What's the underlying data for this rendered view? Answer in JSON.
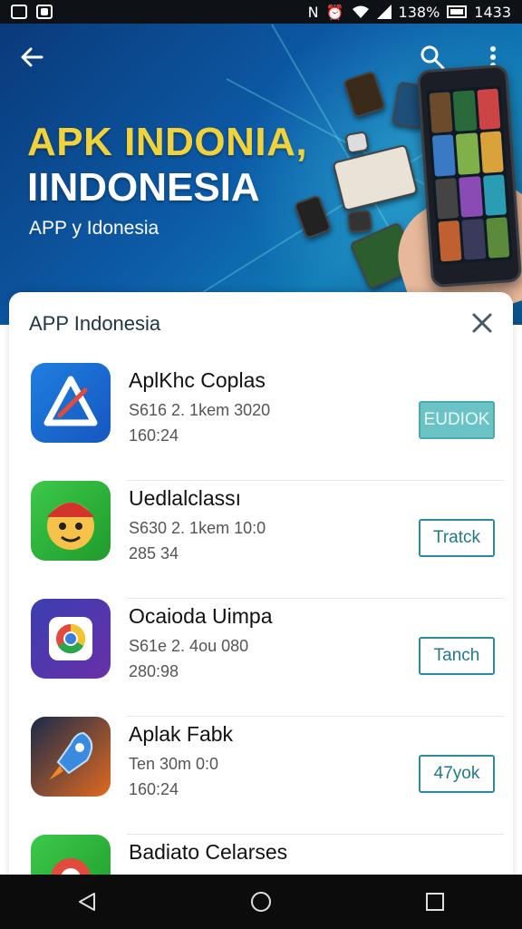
{
  "status_bar": {
    "signal_label": "N",
    "battery_pct": "138%",
    "time": "1433"
  },
  "hero": {
    "title_line1": "APK INDONIA,",
    "title_line2": "IINDONESIA",
    "subtitle": "APP y Idonesia",
    "colors": {
      "title_yellow": "#f2d23a",
      "bg_blue": "#0c5aa6"
    }
  },
  "sheet": {
    "title": "APP Indonesia",
    "apps": [
      {
        "name": "AplKhc Coplas",
        "meta": "S616 2. 1kem 3020",
        "meta2": "160:24",
        "button": "EUDIOK",
        "button_style": "filled",
        "icon": "delta-a-icon"
      },
      {
        "name": "Uedlalclassı",
        "meta": "S630 2. 1kem 10:0",
        "meta2": "285 34",
        "button": "Tratck",
        "button_style": "outline",
        "icon": "emoji-face-icon"
      },
      {
        "name": "Ocaioda Uimpa",
        "meta": "S61e 2. 4ou 080",
        "meta2": "280:98",
        "button": "Tanch",
        "button_style": "outline",
        "icon": "chrome-icon"
      },
      {
        "name": "Aplak Fabk",
        "meta": "Ten 30m 0:0",
        "meta2": "160:24",
        "button": "47yok",
        "button_style": "outline",
        "icon": "rocket-icon"
      },
      {
        "name": "Badiato Celarses",
        "meta": "",
        "meta2": "",
        "button": "",
        "button_style": "none",
        "icon": "green-app-icon"
      }
    ]
  },
  "nav": {
    "back": "back-icon",
    "home": "home-icon",
    "recents": "recents-icon"
  }
}
